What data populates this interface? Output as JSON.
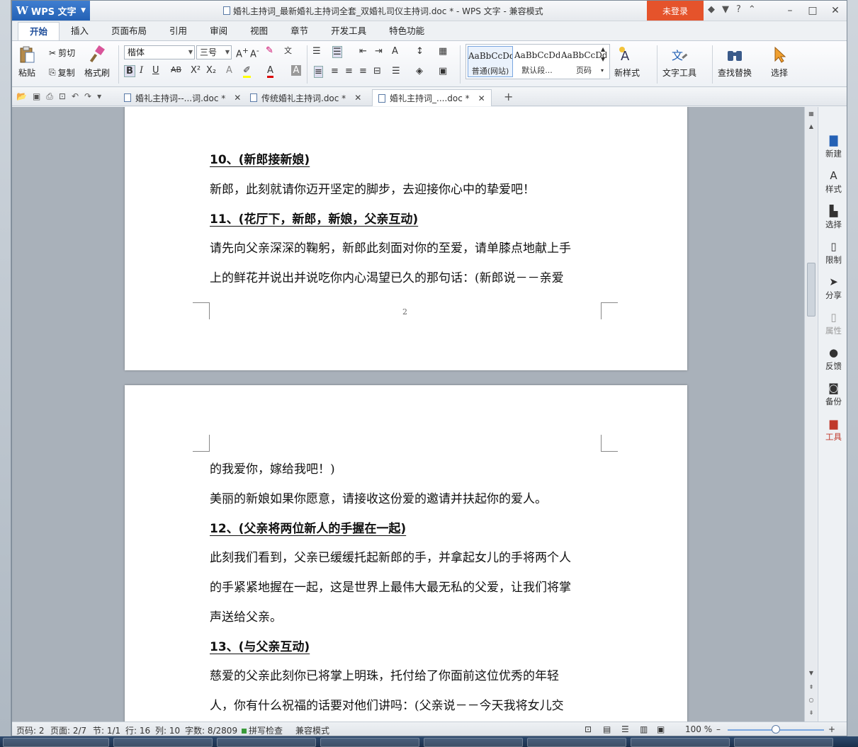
{
  "app": {
    "name": "WPS 文字",
    "title": "婚礼主持词_最新婚礼主持词全套_双婚礼司仪主持词.doc * - WPS 文字 - 兼容模式",
    "login_label": "未登录",
    "help_label": "?"
  },
  "ribbon_tabs": [
    "开始",
    "插入",
    "页面布局",
    "引用",
    "审阅",
    "视图",
    "章节",
    "开发工具",
    "特色功能"
  ],
  "ribbon": {
    "paste": "粘贴",
    "cut": "剪切",
    "copy": "复制",
    "format_painter": "格式刷",
    "font_name": "楷体",
    "font_size": "三号",
    "styles": [
      {
        "sample": "AaBbCcDd",
        "name": "普通(网站)"
      },
      {
        "sample": "AaBbCcDd",
        "name": "默认段..."
      },
      {
        "sample": "AaBbCcDd",
        "name": "页码"
      }
    ],
    "new_style": "新样式",
    "text_tools": "文字工具",
    "find_replace": "查找替换",
    "select": "选择"
  },
  "doc_tabs": [
    {
      "label": "婚礼主持词--...词.doc *"
    },
    {
      "label": "传统婚礼主持词.doc *"
    },
    {
      "label": "婚礼主持词_....doc *"
    }
  ],
  "document": {
    "page1_lines": [
      {
        "text": "10、(新郎接新娘)",
        "heading": true
      },
      {
        "text": "新郎，此刻就请你迈开坚定的脚步，去迎接你心中的挚爱吧！",
        "heading": false
      },
      {
        "text": "11、(花厅下，新郎，新娘，父亲互动)",
        "heading": true
      },
      {
        "text": "请先向父亲深深的鞠躬，新郎此刻面对你的至爱，请单膝点地献上手",
        "heading": false
      },
      {
        "text": "上的鲜花并说出并说吃你内心渴望已久的那句话：(新郎说－－亲爱",
        "heading": false
      }
    ],
    "page_number": "2",
    "page2_lines": [
      {
        "text": "的我爱你，嫁给我吧！)",
        "heading": false
      },
      {
        "text": "美丽的新娘如果你愿意，请接收这份爱的邀请并扶起你的爱人。",
        "heading": false
      },
      {
        "text": "12、(父亲将两位新人的手握在一起)",
        "heading": true
      },
      {
        "text": "此刻我们看到，父亲已缓缓托起新郎的手，并拿起女儿的手将两个人",
        "heading": false
      },
      {
        "text": "的手紧紧地握在一起，这是世界上最伟大最无私的父爱，让我们将掌",
        "heading": false
      },
      {
        "text": "声送给父亲。",
        "heading": false
      },
      {
        "text": "13、(与父亲互动)",
        "heading": true
      },
      {
        "text": "慈爱的父亲此刻你已将掌上明珠，托付给了你面前这位优秀的年轻",
        "heading": false
      },
      {
        "text": "人，你有什么祝福的话要对他们讲吗：(父亲说－－今天我将女儿交",
        "heading": false
      }
    ]
  },
  "side_panel": [
    {
      "label": "新建",
      "icon": "new-doc-icon"
    },
    {
      "label": "样式",
      "icon": "style-icon"
    },
    {
      "label": "选择",
      "icon": "select-icon"
    },
    {
      "label": "限制",
      "icon": "restrict-icon"
    },
    {
      "label": "分享",
      "icon": "share-icon"
    },
    {
      "label": "属性",
      "icon": "properties-icon"
    },
    {
      "label": "反馈",
      "icon": "feedback-icon"
    },
    {
      "label": "备份",
      "icon": "backup-icon"
    },
    {
      "label": "工具",
      "icon": "toolbox-icon"
    }
  ],
  "status": {
    "page_code": "页码: 2",
    "pages": "页面: 2/7",
    "section": "节: 1/1",
    "row": "行: 16",
    "col": "列: 10",
    "words": "字数: 8/2809",
    "spell": "拼写检查",
    "compat": "兼容模式",
    "zoom": "100 %"
  },
  "colors": {
    "accent": "#2461b5",
    "login": "#e5532b"
  }
}
